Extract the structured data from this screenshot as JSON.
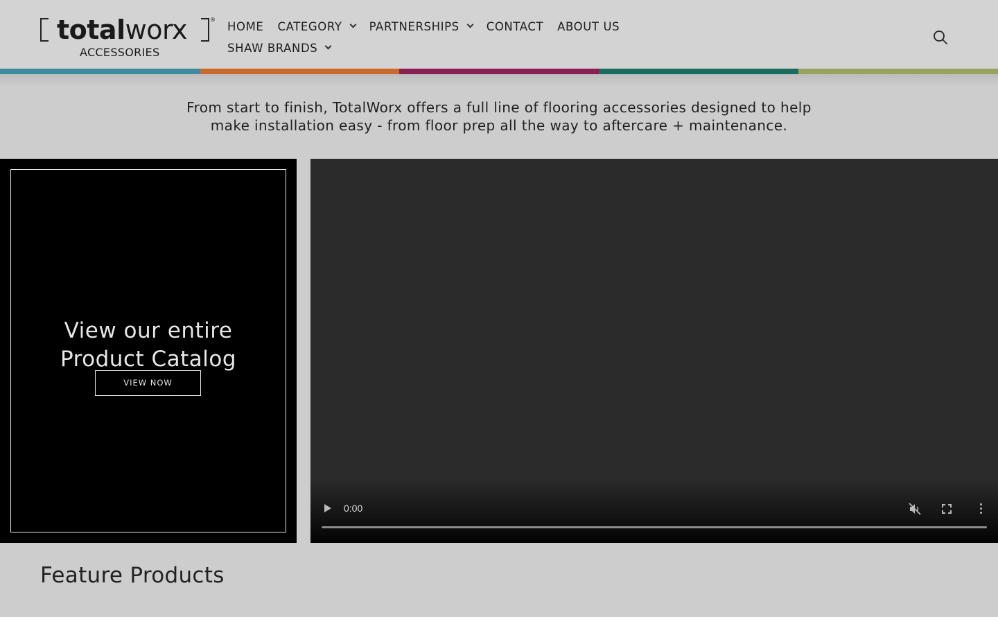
{
  "logo": {
    "word_bold": "total",
    "word_light": "worx",
    "registered": "®",
    "subtitle": "ACCESSORIES"
  },
  "nav": {
    "row1": [
      {
        "label": "HOME",
        "has_dropdown": false
      },
      {
        "label": "CATEGORY",
        "has_dropdown": true
      },
      {
        "label": "PARTNERSHIPS",
        "has_dropdown": true
      },
      {
        "label": "CONTACT",
        "has_dropdown": false
      },
      {
        "label": "ABOUT US",
        "has_dropdown": false
      }
    ],
    "row2": [
      {
        "label": "SHAW BRANDS",
        "has_dropdown": true
      }
    ]
  },
  "search_icon": "search-icon",
  "stripe_colors": [
    "#3f8a9c",
    "#c96a2c",
    "#862056",
    "#1b6b5e",
    "#99a35c"
  ],
  "intro": {
    "line1": "From start to finish, TotalWorx offers a full line of flooring accessories designed to help",
    "line2": "make installation easy - from floor prep all the way to aftercare + maintenance."
  },
  "catalog": {
    "title_line1": "View our entire",
    "title_line2": "Product Catalog",
    "button": "VIEW NOW"
  },
  "video": {
    "time": "0:00",
    "muted": true,
    "progress": 0
  },
  "feature": {
    "title": "Feature Products"
  }
}
